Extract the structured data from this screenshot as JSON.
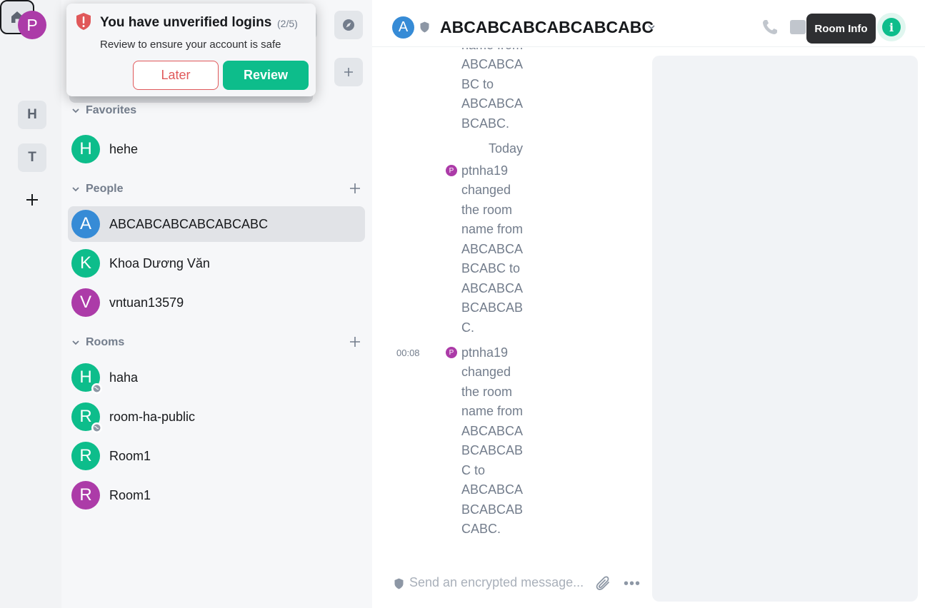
{
  "spaces": {
    "user_initial": "P",
    "items": [
      {
        "initial": "H"
      },
      {
        "initial": "T"
      }
    ]
  },
  "toast": {
    "title": "You have unverified logins",
    "count": "(2/5)",
    "description": "Review to ensure your account is safe",
    "later_label": "Later",
    "review_label": "Review"
  },
  "room_list": {
    "sections": {
      "favorites": "Favorites",
      "people": "People",
      "rooms": "Rooms"
    },
    "favorites": [
      {
        "initial": "H",
        "name": "hehe",
        "color": "#0dbd8b"
      }
    ],
    "people": [
      {
        "initial": "A",
        "name": "ABCABCABCABCABCABC",
        "color": "#368bd6"
      },
      {
        "initial": "K",
        "name": "Khoa Dương Văn",
        "color": "#0dbd8b"
      },
      {
        "initial": "V",
        "name": "vntuan13579",
        "color": "#ac3ba8"
      }
    ],
    "rooms": [
      {
        "initial": "H",
        "name": "haha",
        "color": "#0dbd8b",
        "public": true
      },
      {
        "initial": "R",
        "name": "room-ha-public",
        "color": "#0dbd8b",
        "public": true
      },
      {
        "initial": "R",
        "name": "Room1",
        "color": "#0dbd8b",
        "public": false
      },
      {
        "initial": "R",
        "name": "Room1",
        "color": "#ac3ba8",
        "public": false
      }
    ]
  },
  "header": {
    "avatar_initial": "A",
    "title": "ABCABCABCABCABCABC",
    "tooltip": "Room Info",
    "info_glyph": "i"
  },
  "timeline": {
    "event0_tail": [
      "name from",
      "ABCABCA",
      "BC to",
      "ABCABCA",
      "BCABC."
    ],
    "date_separator": "Today",
    "event1": {
      "avatar_initial": "P",
      "lines": [
        "ptnha19",
        "changed",
        "the room",
        "name from",
        "ABCABCA",
        "BCABC to",
        "ABCABCA",
        "BCABCAB",
        "C."
      ]
    },
    "event2": {
      "time": "00:08",
      "avatar_initial": "P",
      "lines": [
        "ptnha19",
        "changed",
        "the room",
        "name from",
        "ABCABCA",
        "BCABCAB",
        "C to",
        "ABCABCA",
        "BCABCAB",
        "CABC."
      ]
    }
  },
  "composer": {
    "placeholder": "Send an encrypted message...",
    "more_glyph": "•••"
  },
  "colors": {
    "accent": "#0dbd8b",
    "alert": "#e0585a",
    "user_avatar": "#ac3ba8",
    "blue_avatar": "#368bd6"
  }
}
